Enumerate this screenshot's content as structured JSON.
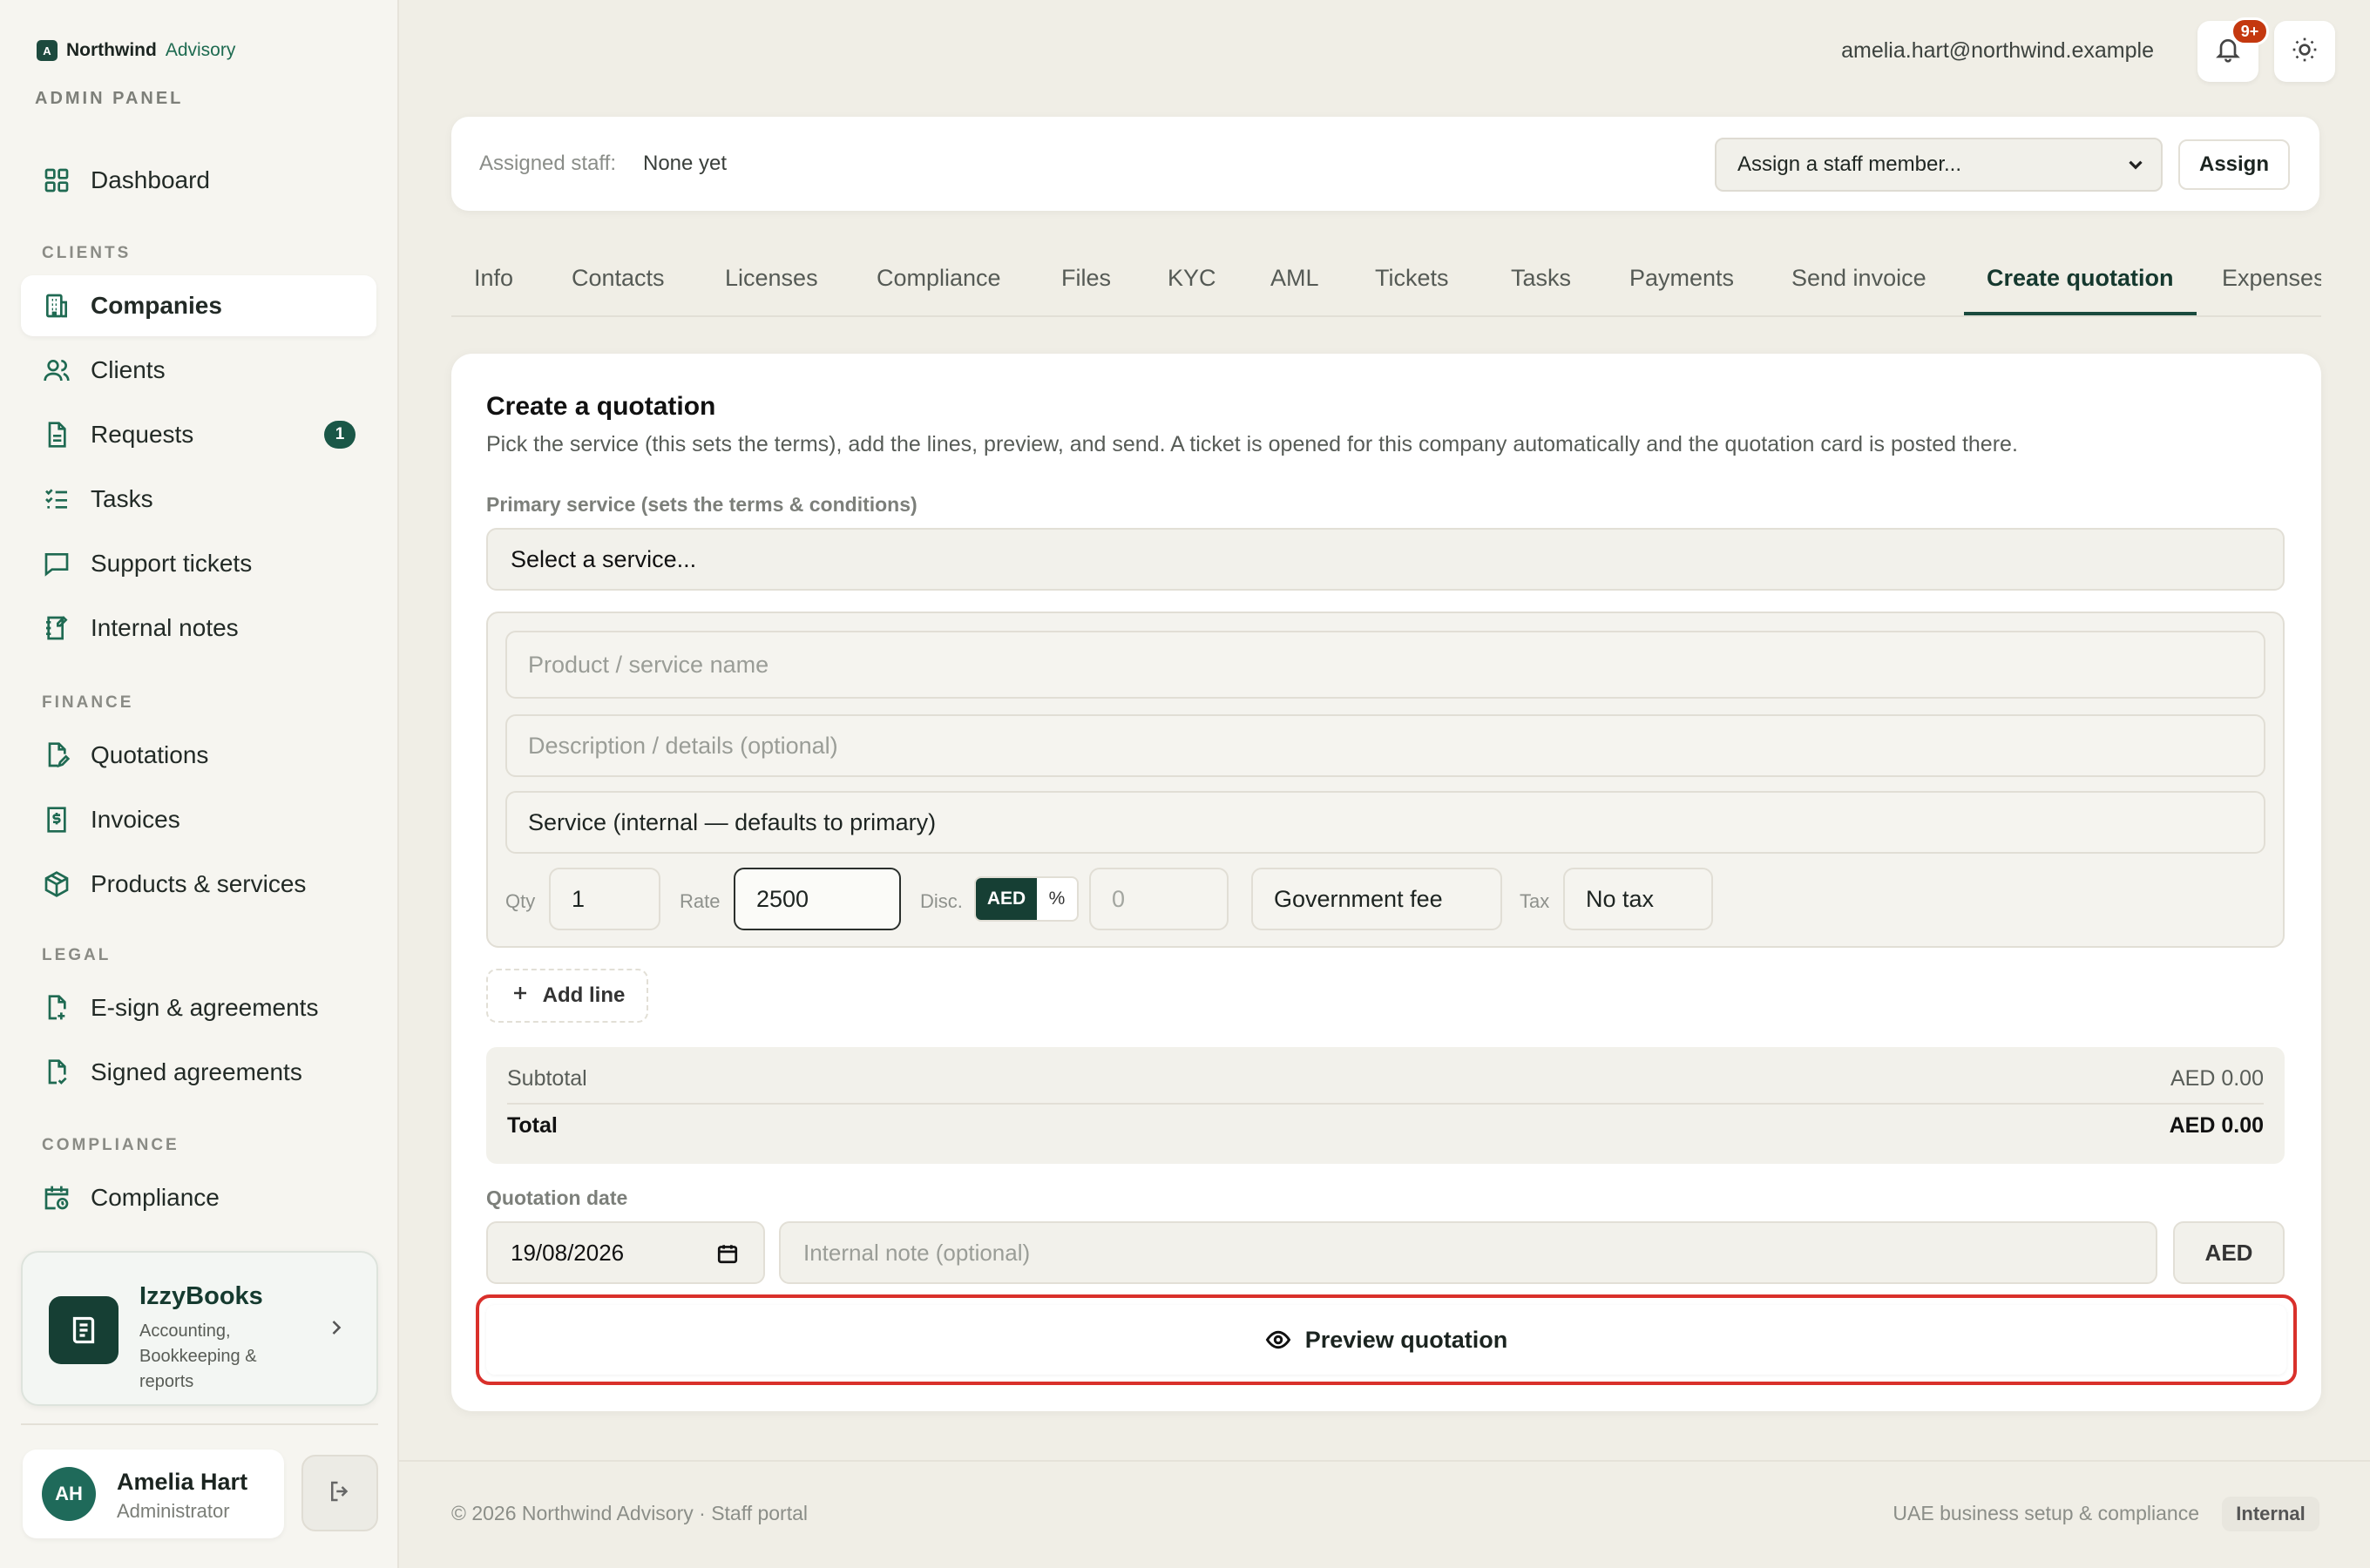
{
  "brand": {
    "logo_letter": "A",
    "name": "Northwind",
    "sub": "Advisory",
    "panel_label": "ADMIN PANEL"
  },
  "sidebar": {
    "items": [
      {
        "label": "Dashboard",
        "icon": "grid-icon"
      },
      {
        "label": "Companies",
        "icon": "building-icon"
      },
      {
        "label": "Clients",
        "icon": "users-icon"
      },
      {
        "label": "Requests",
        "icon": "file-icon",
        "badge": "1"
      },
      {
        "label": "Tasks",
        "icon": "checklist-icon"
      },
      {
        "label": "Support tickets",
        "icon": "message-icon"
      },
      {
        "label": "Internal notes",
        "icon": "notebook-icon"
      },
      {
        "label": "Quotations",
        "icon": "file-edit-icon"
      },
      {
        "label": "Invoices",
        "icon": "receipt-icon"
      },
      {
        "label": "Products & services",
        "icon": "box-icon"
      },
      {
        "label": "E-sign & agreements",
        "icon": "file-sign-icon"
      },
      {
        "label": "Signed agreements",
        "icon": "file-check-icon"
      },
      {
        "label": "Compliance",
        "icon": "calendar-clock-icon"
      }
    ],
    "sections": {
      "clients": "CLIENTS",
      "finance": "FINANCE",
      "legal": "LEGAL",
      "compliance": "COMPLIANCE"
    }
  },
  "izzybooks": {
    "title": "IzzyBooks",
    "desc": "Accounting, Bookkeeping & reports"
  },
  "user": {
    "initials": "AH",
    "name": "Amelia Hart",
    "role": "Administrator"
  },
  "topbar": {
    "email": "amelia.hart@northwind.example",
    "notif_count": "9+"
  },
  "assign": {
    "label": "Assigned staff:",
    "value": "None yet",
    "select_value": "Assign a staff member...",
    "button": "Assign"
  },
  "tabs": [
    "Info",
    "Contacts",
    "Licenses",
    "Compliance",
    "Files",
    "KYC",
    "AML",
    "Tickets",
    "Tasks",
    "Payments",
    "Send invoice",
    "Create quotation",
    "Expenses"
  ],
  "quotation": {
    "title": "Create a quotation",
    "desc": "Pick the service (this sets the terms), add the lines, preview, and send. A ticket is opened for this company automatically and the quotation card is posted there.",
    "service_label": "Primary service (sets the terms & conditions)",
    "service_value": "Select a service...",
    "line": {
      "name_placeholder": "Product / service name",
      "desc_placeholder": "Description / details (optional)",
      "service_internal": "Service (internal — defaults to primary)",
      "qty_label": "Qty",
      "qty": "1",
      "rate_label": "Rate",
      "rate": "2500",
      "disc_label": "Disc.",
      "disc_aed": "AED",
      "disc_pct": "%",
      "disc_value": "0",
      "fee_type": "Government fee",
      "tax_label": "Tax",
      "tax": "No tax"
    },
    "add_line": "Add line",
    "subtotal_label": "Subtotal",
    "subtotal": "AED 0.00",
    "total_label": "Total",
    "total": "AED 0.00",
    "date_label": "Quotation date",
    "date": "19/08/2026",
    "note_placeholder": "Internal note (optional)",
    "currency": "AED",
    "preview_button": "Preview quotation"
  },
  "footer": {
    "left": "© 2026 Northwind Advisory · Staff portal",
    "right": "UAE business setup & compliance",
    "badge": "Internal"
  },
  "colors": {
    "accent": "#1a4a3e",
    "highlight": "#d9302b",
    "badge": "#c4380f"
  }
}
